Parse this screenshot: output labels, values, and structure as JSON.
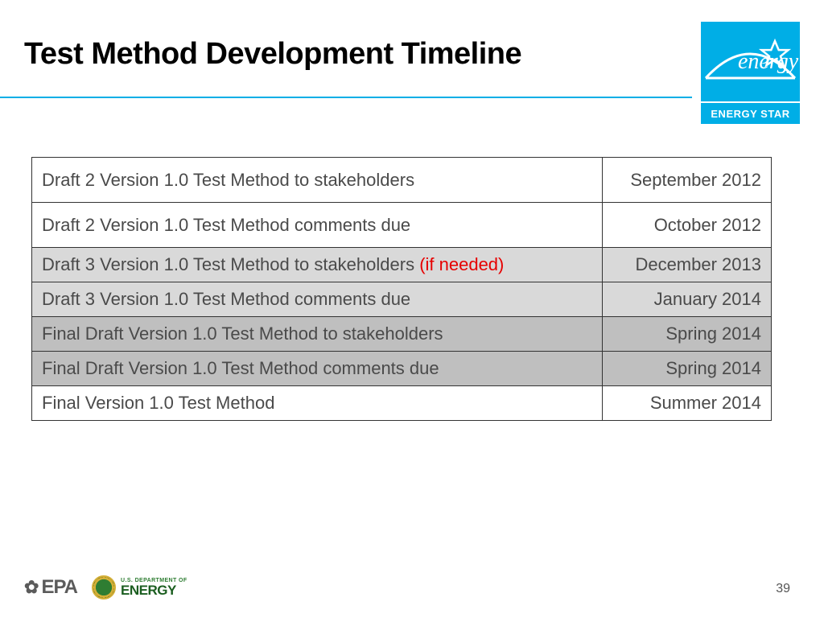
{
  "title": "Test Method Development Timeline",
  "energy_star": {
    "label": "ENERGY STAR",
    "script_text": "energy"
  },
  "rows": [
    {
      "label": "Draft 2 Version 1.0 Test Method to stakeholders",
      "highlight": "",
      "date": "September 2012",
      "shade": "white"
    },
    {
      "label": "Draft 2 Version 1.0 Test Method comments due",
      "highlight": "",
      "date": "October 2012",
      "shade": "white"
    },
    {
      "label": "Draft 3 Version 1.0 Test Method to stakeholders ",
      "highlight": "(if needed)",
      "date": "December 2013",
      "shade": "light"
    },
    {
      "label": "Draft 3 Version 1.0 Test Method comments due",
      "highlight": "",
      "date": "January 2014",
      "shade": "light"
    },
    {
      "label": "Final Draft Version 1.0 Test Method to stakeholders",
      "highlight": "",
      "date": "Spring 2014",
      "shade": "med"
    },
    {
      "label": "Final Draft Version 1.0 Test Method comments due",
      "highlight": "",
      "date": "Spring 2014",
      "shade": "med"
    },
    {
      "label": "Final Version 1.0 Test Method",
      "highlight": "",
      "date": "Summer 2014",
      "shade": "final"
    }
  ],
  "footer": {
    "epa": "EPA",
    "doe_sup": "U.S. DEPARTMENT OF",
    "doe_main": "ENERGY"
  },
  "page_number": "39"
}
